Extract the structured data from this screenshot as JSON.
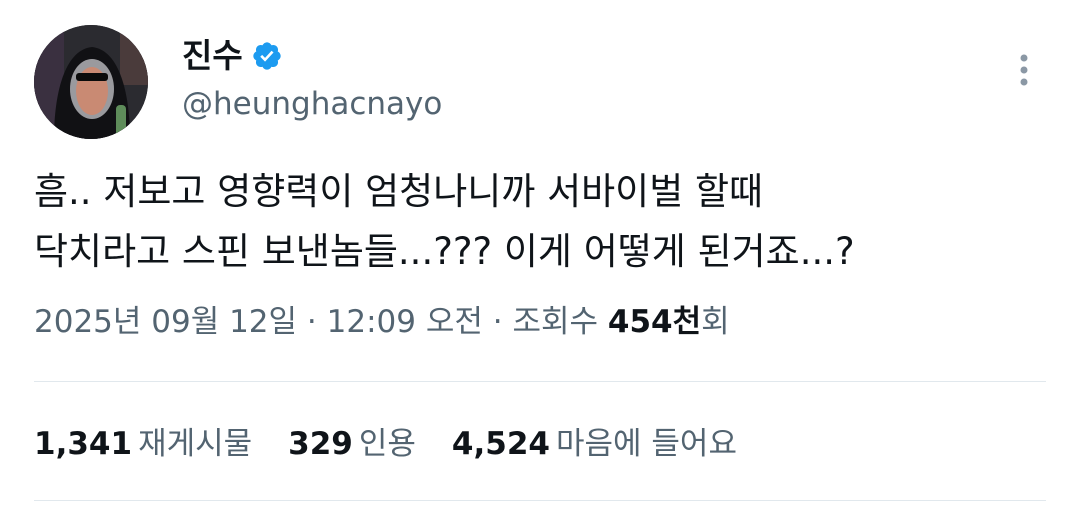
{
  "author": {
    "display_name": "진수",
    "handle": "@heunghacnayo",
    "verified": true
  },
  "tweet": {
    "lines": [
      "흠.. 저보고 영향력이 엄청나니까 서바이벌 할때",
      "닥치라고 스핀 보낸놈들...??? 이게 어떻게 된거죠...?"
    ]
  },
  "meta": {
    "date": "2025년 09월 12일",
    "separator": "·",
    "time": "12:09 오전",
    "views_label": "조회수",
    "views_count": "454천",
    "views_suffix": "회"
  },
  "stats": [
    {
      "count": "1,341",
      "label": "재게시물"
    },
    {
      "count": "329",
      "label": "인용"
    },
    {
      "count": "4,524",
      "label": "마음에 들어요"
    }
  ],
  "colors": {
    "text": "#0f1419",
    "secondary": "#536471",
    "verified": "#1d9bf0",
    "divider": "#e1e8ed"
  },
  "icons": {
    "verified": "verified-badge-icon",
    "more": "more-vertical-icon"
  }
}
